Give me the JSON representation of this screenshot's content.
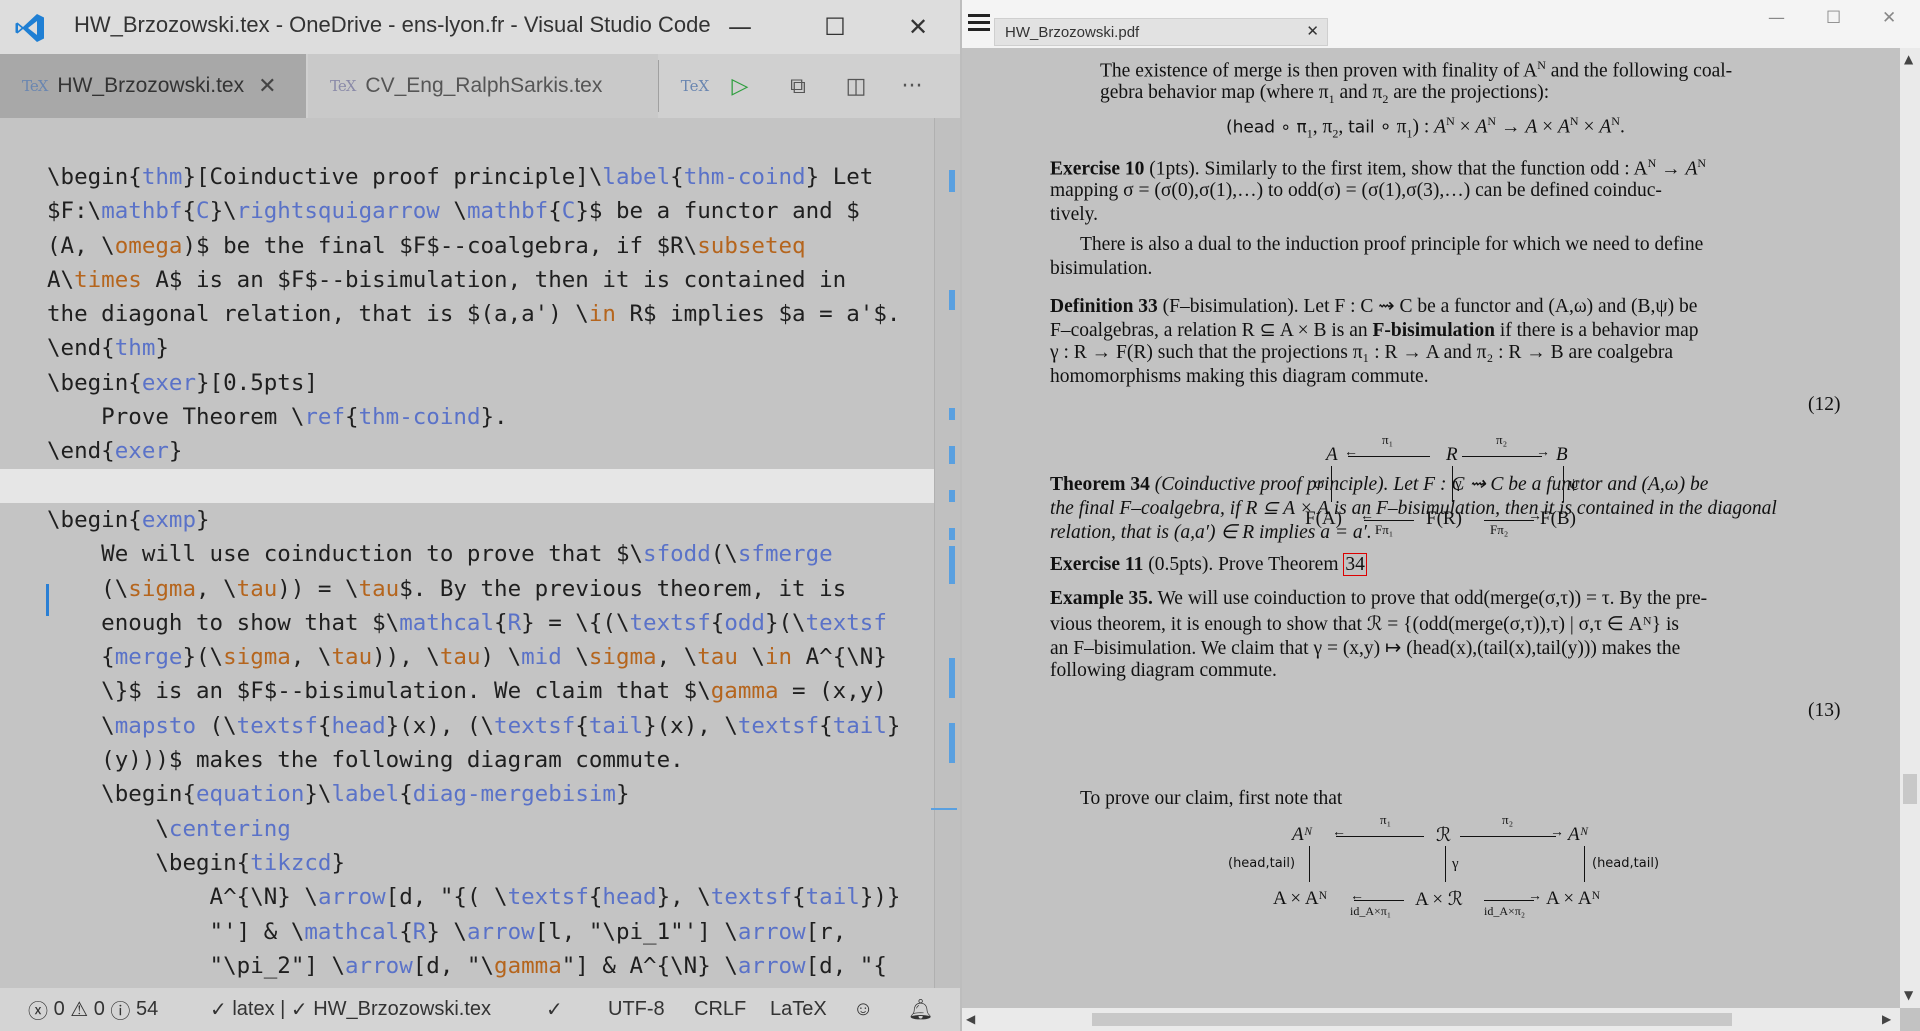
{
  "vscode": {
    "title": "HW_Brzozowski.tex - OneDrive - ens-lyon.fr - Visual Studio Code",
    "window_controls": {
      "minimize": "—",
      "maximize": "☐",
      "close": "✕"
    },
    "tabs": [
      {
        "icon": "TeX",
        "label": "HW_Brzozowski.tex",
        "close": "✕"
      },
      {
        "icon": "TeX",
        "label": "CV_Eng_RalphSarkis.tex"
      }
    ],
    "toolbar": {
      "build_icon": "TeX",
      "run_icon": "▷",
      "preview_icon": "⧉",
      "split_icon": "◫",
      "more": "···"
    },
    "code_lines": [
      "\\begin{thm}[Coinductive proof principle]\\label{thm-coind} Let",
      "$F:\\mathbf{C}\\rightsquigarrow \\mathbf{C}$ be a functor and $",
      "(A, \\omega)$ be the final $F$--coalgebra, if $R\\subseteq",
      "A\\times A$ is an $F$--bisimulation, then it is contained in",
      "the diagonal relation, that is $(a,a') \\in R$ implies $a = a'$.",
      "\\end{thm}",
      "\\begin{exer}[0.5pts]",
      "    Prove Theorem \\ref{thm-coind}.",
      "\\end{exer}",
      "",
      "\\begin{exmp}",
      "    We will use coinduction to prove that $\\sfodd(\\sfmerge",
      "    (\\sigma, \\tau)) = \\tau$. By the previous theorem, it is",
      "    enough to show that $\\mathcal{R} = \\{(\\textsf{odd}(\\textsf",
      "    {merge}(\\sigma, \\tau)), \\tau) \\mid \\sigma, \\tau \\in A^{\\N}",
      "    \\}$ is an $F$--bisimulation. We claim that $\\gamma = (x,y)",
      "    \\mapsto (\\textsf{head}(x), (\\textsf{tail}(x), \\textsf{tail}",
      "    (y)))$ makes the following diagram commute.",
      "    \\begin{equation}\\label{diag-mergebisim}",
      "        \\centering",
      "        \\begin{tikzcd}",
      "            A^{\\N} \\arrow[d, \"{( \\textsf{head}, \\textsf{tail})}",
      "            \"'] & \\mathcal{R} \\arrow[l, \"\\pi_1\"'] \\arrow[r,",
      "            \"\\pi_2\"] \\arrow[d, \"\\gamma\"] & A^{\\N} \\arrow[d, \"{"
    ],
    "status": {
      "errors": "0",
      "warnings": "0",
      "infos": "54",
      "latex": "latex",
      "file": "HW_Brzozowski.tex",
      "encoding": "UTF-8",
      "eol": "CRLF",
      "language": "LaTeX"
    }
  },
  "pdf": {
    "tab_title": "HW_Brzozowski.pdf",
    "tab_close": "✕",
    "window_controls": {
      "minimize": "—",
      "maximize": "☐",
      "close": "✕"
    },
    "lines": {
      "p1a": "The existence of merge is then proven with finality of A",
      "p1b": "gebra behavior map (where π",
      "p1eq": "(head ∘ π",
      "ex10_head": "Exercise 10",
      "ex10_a": "(1pts). Similarly to the first item, show that the function odd : A",
      "ex10_b": "mapping σ = (σ(0),σ(1),…) to odd(σ) = (σ(1),σ(3),…) can be defined coinduc-",
      "ex10_c": "tively.",
      "dual_a": "There is also a dual to the induction proof principle for which we need to define",
      "dual_b": "bisimulation.",
      "def33_head": "Definition 33",
      "def33_a": "(F–bisimulation). Let F : C ⇝ C be a functor and (A,ω) and (B,ψ) be",
      "def33_b1": "F–coalgebras, a relation R ⊆ A × B is an",
      "def33_b2": "F-bisimulation",
      "def33_b3": "if there is a behavior map",
      "def33_c": "γ : R → F(R) such that the projections π₁ : R → A and π₂ : R → B are coalgebra",
      "def33_d": "homomorphisms making this diagram commute.",
      "eq12": "(12)",
      "thm34_head": "Theorem 34",
      "thm34_a": "(Coinductive proof principle). Let F : C ⇝ C be a functor and (A,ω) be",
      "thm34_b": "the final F–coalgebra, if R ⊆ A × A is an F–bisimulation, then it is contained in the diagonal",
      "thm34_c": "relation, that is (a,a′) ∈ R implies a = a′.",
      "ex11_head": "Exercise 11",
      "ex11_a": "(0.5pts). Prove Theorem",
      "ex11_ref": "34",
      "exmp35_head": "Example 35.",
      "exmp35_a": "We will use coinduction to prove that odd(merge(σ,τ)) = τ. By the pre-",
      "exmp35_b": "vious theorem, it is enough to show that ℛ = {(odd(merge(σ,τ)),τ) | σ,τ ∈ Aᴺ} is",
      "exmp35_c": "an F–bisimulation. We claim that γ = (x,y) ↦ (head(x),(tail(x),tail(y))) makes the",
      "exmp35_d": "following diagram commute.",
      "eq13": "(13)",
      "claim": "To prove our claim, first note that"
    },
    "diag12": {
      "A": "A",
      "R": "R",
      "B": "B",
      "FA": "F(A)",
      "FR": "F(R)",
      "FB": "F(B)",
      "pi1": "π₁",
      "pi2": "π₂",
      "omega": "ω",
      "gamma": "γ",
      "psi": "ψ",
      "Fpi1": "Fπ₁",
      "Fpi2": "Fπ₂"
    },
    "diag13": {
      "AN1": "Aᴺ",
      "R": "ℛ",
      "AN2": "Aᴺ",
      "AxAN": "A × Aᴺ",
      "AxR": "A × ℛ",
      "AxAN2": "A × Aᴺ",
      "pi1": "π₁",
      "pi2": "π₂",
      "headtail1": "(head,tail)",
      "gamma": "γ",
      "headtail2": "(head,tail)",
      "idpi1": "id_A×π₁",
      "idpi2": "id_A×π₂"
    }
  }
}
